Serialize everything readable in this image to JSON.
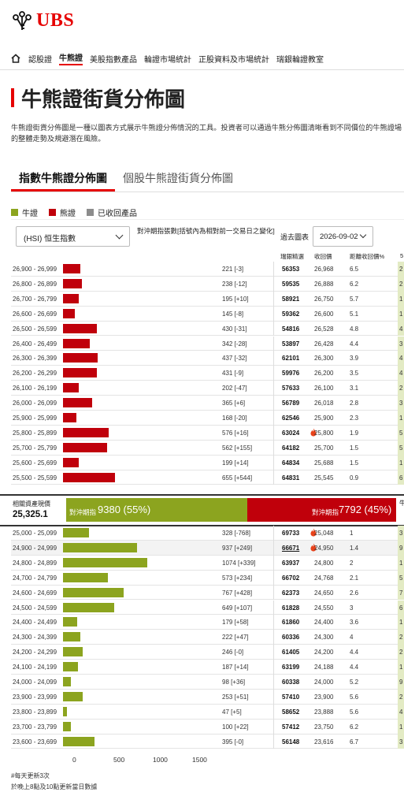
{
  "brand": {
    "logo_text": "UBS",
    "logo_icon": "keys-icon",
    "accent": "#e60000"
  },
  "nav": {
    "home_icon": "home-icon",
    "items": [
      {
        "label": "認股證",
        "active": false
      },
      {
        "label": "牛熊證",
        "active": true
      },
      {
        "label": "美股指數產品",
        "active": false
      },
      {
        "label": "輪證市場統計",
        "active": false
      },
      {
        "label": "正股資料及市場統計",
        "active": false
      },
      {
        "label": "瑞銀輪證教室",
        "active": false
      }
    ]
  },
  "page": {
    "title": "牛熊證街貨分佈圖",
    "description": "牛熊證街貨分佈圖是一種以圖表方式展示牛熊證分佈情況的工具。投資者可以通過牛熊分佈圖清晰看到不同價位的牛熊證場的整體走勢及規避潛在風險。"
  },
  "tabs": [
    {
      "label": "指數牛熊證分佈圖",
      "active": true
    },
    {
      "label": "個股牛熊證街貨分佈圖",
      "active": false
    }
  ],
  "legend": [
    {
      "label": "牛證",
      "color": "#8ca41f"
    },
    {
      "label": "熊證",
      "color": "#c0000b"
    },
    {
      "label": "已收回產品",
      "color": "#8c8c8c"
    }
  ],
  "controls": {
    "index_select": "(HSI) 恒生指數",
    "hedge_note": "對沖期指張數[括號內為相對前一交易日之變化]",
    "past_chart_label": "過去圖表",
    "date_value": "2026-09-02"
  },
  "columns": {
    "code": "瑞銀精選",
    "call_price": "收回價",
    "distance": "距離收回價%",
    "last": "5"
  },
  "chart_data": {
    "type": "bar",
    "orientation": "horizontal",
    "x_ticks": [
      "0",
      "500",
      "1000",
      "1500"
    ],
    "xlim": [
      0,
      1500
    ],
    "bear_rows": [
      {
        "range": "26,900 - 26,999",
        "value": 221,
        "count": "221 [-3]",
        "code": "56353",
        "call_price": "26,968",
        "distance": "6.5",
        "last": "2"
      },
      {
        "range": "26,800 - 26,899",
        "value": 238,
        "count": "238 [-12]",
        "code": "59535",
        "call_price": "26,888",
        "distance": "6.2",
        "last": "2"
      },
      {
        "range": "26,700 - 26,799",
        "value": 195,
        "count": "195 [+10]",
        "code": "58921",
        "call_price": "26,750",
        "distance": "5.7",
        "last": "1"
      },
      {
        "range": "26,600 - 26,699",
        "value": 145,
        "count": "145 [-8]",
        "code": "59362",
        "call_price": "26,600",
        "distance": "5.1",
        "last": "1"
      },
      {
        "range": "26,500 - 26,599",
        "value": 430,
        "count": "430 [-31]",
        "code": "54816",
        "call_price": "26,528",
        "distance": "4.8",
        "last": "4"
      },
      {
        "range": "26,400 - 26,499",
        "value": 342,
        "count": "342 [-28]",
        "code": "53897",
        "call_price": "26,428",
        "distance": "4.4",
        "last": "3"
      },
      {
        "range": "26,300 - 26,399",
        "value": 437,
        "count": "437 [-32]",
        "code": "62101",
        "call_price": "26,300",
        "distance": "3.9",
        "last": "4"
      },
      {
        "range": "26,200 - 26,299",
        "value": 431,
        "count": "431 [-9]",
        "code": "59976",
        "call_price": "26,200",
        "distance": "3.5",
        "last": "4"
      },
      {
        "range": "26,100 - 26,199",
        "value": 202,
        "count": "202 [-47]",
        "code": "57633",
        "call_price": "26,100",
        "distance": "3.1",
        "last": "2"
      },
      {
        "range": "26,000 - 26,099",
        "value": 365,
        "count": "365 [+6]",
        "code": "56789",
        "call_price": "26,018",
        "distance": "2.8",
        "last": "3"
      },
      {
        "range": "25,900 - 25,999",
        "value": 168,
        "count": "168 [-20]",
        "code": "62546",
        "call_price": "25,900",
        "distance": "2.3",
        "last": "1"
      },
      {
        "range": "25,800 - 25,899",
        "value": 576,
        "count": "576 [+16]",
        "code": "63024",
        "flame": true,
        "call_price": "25,800",
        "distance": "1.9",
        "last": "5"
      },
      {
        "range": "25,700 - 25,799",
        "value": 562,
        "count": "562 [+155]",
        "code": "64182",
        "call_price": "25,700",
        "distance": "1.5",
        "last": "5"
      },
      {
        "range": "25,600 - 25,699",
        "value": 199,
        "count": "199 [+14]",
        "code": "64834",
        "call_price": "25,688",
        "distance": "1.5",
        "last": "1"
      },
      {
        "range": "25,500 - 25,599",
        "value": 655,
        "count": "655 [+544]",
        "code": "64831",
        "call_price": "25,545",
        "distance": "0.9",
        "last": "6"
      }
    ],
    "bull_rows": [
      {
        "range": "25,000 - 25,099",
        "value": 328,
        "count": "328 [-768]",
        "code": "69733",
        "flame": true,
        "call_price": "25,048",
        "distance": "1",
        "last": "3"
      },
      {
        "range": "24,900 - 24,999",
        "value": 937,
        "count": "937 [+249]",
        "code": "66671",
        "flame": true,
        "underline": true,
        "call_price": "24,950",
        "distance": "1.4",
        "last": "9"
      },
      {
        "range": "24,800 - 24,899",
        "value": 1074,
        "count": "1074 [+339]",
        "code": "63937",
        "call_price": "24,800",
        "distance": "2",
        "last": "1"
      },
      {
        "range": "24,700 - 24,799",
        "value": 573,
        "count": "573 [+234]",
        "code": "66702",
        "call_price": "24,768",
        "distance": "2.1",
        "last": "5"
      },
      {
        "range": "24,600 - 24,699",
        "value": 767,
        "count": "767 [+428]",
        "code": "62373",
        "call_price": "24,650",
        "distance": "2.6",
        "last": "7"
      },
      {
        "range": "24,500 - 24,599",
        "value": 649,
        "count": "649 [+107]",
        "code": "61828",
        "call_price": "24,550",
        "distance": "3",
        "last": "6"
      },
      {
        "range": "24,400 - 24,499",
        "value": 179,
        "count": "179 [+58]",
        "code": "61860",
        "call_price": "24,400",
        "distance": "3.6",
        "last": "1"
      },
      {
        "range": "24,300 - 24,399",
        "value": 222,
        "count": "222 [+47]",
        "code": "60336",
        "call_price": "24,300",
        "distance": "4",
        "last": "2"
      },
      {
        "range": "24,200 - 24,299",
        "value": 246,
        "count": "246 [-0]",
        "code": "61405",
        "call_price": "24,200",
        "distance": "4.4",
        "last": "2"
      },
      {
        "range": "24,100 - 24,199",
        "value": 187,
        "count": "187 [+14]",
        "code": "63199",
        "call_price": "24,188",
        "distance": "4.4",
        "last": "1"
      },
      {
        "range": "24,000 - 24,099",
        "value": 98,
        "count": "98 [+36]",
        "code": "60338",
        "call_price": "24,000",
        "distance": "5.2",
        "last": "9"
      },
      {
        "range": "23,900 - 23,999",
        "value": 253,
        "count": "253 [+51]",
        "code": "57410",
        "call_price": "23,900",
        "distance": "5.6",
        "last": "2"
      },
      {
        "range": "23,800 - 23,899",
        "value": 47,
        "count": "47 [+5]",
        "code": "58652",
        "call_price": "23,888",
        "distance": "5.6",
        "last": "4"
      },
      {
        "range": "23,700 - 23,799",
        "value": 100,
        "count": "100 [+22]",
        "code": "57412",
        "call_price": "23,750",
        "distance": "6.2",
        "last": "1"
      },
      {
        "range": "23,600 - 23,699",
        "value": 395,
        "count": "395 [-0]",
        "code": "56148",
        "call_price": "23,616",
        "distance": "6.7",
        "last": "3"
      }
    ]
  },
  "summary": {
    "spot_label": "相關資產現價",
    "spot_value": "25,325.1",
    "bull_label": "對沖期指",
    "bull_value": "9380 (55%)",
    "bull_share": 0.55,
    "bear_label": "對沖期指",
    "bear_value": "7792 (45%)",
    "bear_share": 0.45,
    "edge_label": "牛"
  },
  "notes": [
    "#每天更新3次",
    "於晚上8點及10點更新當日數據"
  ]
}
